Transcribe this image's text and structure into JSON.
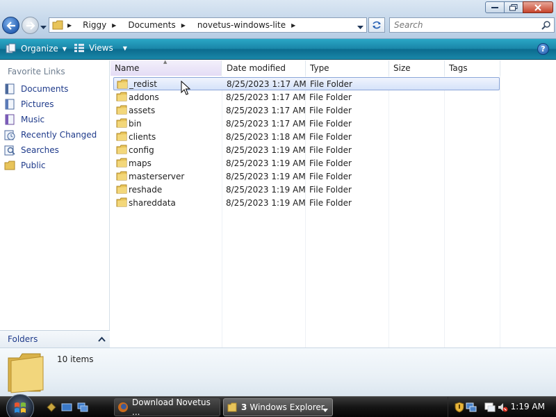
{
  "window": {
    "controls": [
      "minimize",
      "maximize",
      "close"
    ]
  },
  "address": {
    "crumbs": [
      "Riggy",
      "Documents",
      "novetus-windows-lite"
    ]
  },
  "search": {
    "placeholder": "Search"
  },
  "commandbar": {
    "organize": "Organize",
    "views": "Views",
    "help": "?"
  },
  "navpane": {
    "heading": "Favorite Links",
    "items": [
      {
        "label": "Documents",
        "icon": "documents-icon"
      },
      {
        "label": "Pictures",
        "icon": "pictures-icon"
      },
      {
        "label": "Music",
        "icon": "music-icon"
      },
      {
        "label": "Recently Changed",
        "icon": "recently-changed-icon"
      },
      {
        "label": "Searches",
        "icon": "searches-icon"
      },
      {
        "label": "Public",
        "icon": "public-folder-icon"
      }
    ],
    "folders_label": "Folders"
  },
  "columns": [
    "Name",
    "Date modified",
    "Type",
    "Size",
    "Tags"
  ],
  "files": [
    {
      "name": "_redist",
      "date": "8/25/2023 1:17 AM",
      "type": "File Folder",
      "selected": true
    },
    {
      "name": "addons",
      "date": "8/25/2023 1:17 AM",
      "type": "File Folder"
    },
    {
      "name": "assets",
      "date": "8/25/2023 1:17 AM",
      "type": "File Folder"
    },
    {
      "name": "bin",
      "date": "8/25/2023 1:17 AM",
      "type": "File Folder"
    },
    {
      "name": "clients",
      "date": "8/25/2023 1:18 AM",
      "type": "File Folder"
    },
    {
      "name": "config",
      "date": "8/25/2023 1:19 AM",
      "type": "File Folder"
    },
    {
      "name": "maps",
      "date": "8/25/2023 1:19 AM",
      "type": "File Folder"
    },
    {
      "name": "masterserver",
      "date": "8/25/2023 1:19 AM",
      "type": "File Folder"
    },
    {
      "name": "reshade",
      "date": "8/25/2023 1:19 AM",
      "type": "File Folder"
    },
    {
      "name": "shareddata",
      "date": "8/25/2023 1:19 AM",
      "type": "File Folder"
    }
  ],
  "details": {
    "count": "10 items"
  },
  "taskbar": {
    "buttons": [
      {
        "label": "Download Novetus ...",
        "icon": "firefox-icon"
      },
      {
        "label_count": "3",
        "label": "Windows Explorer",
        "icon": "folder-icon"
      }
    ],
    "clock": "1:19 AM"
  },
  "colors": {
    "accent": "#1a86a8",
    "link": "#1e3a8a",
    "selection": "#d5e2f9",
    "folder": "#e8c45a"
  }
}
